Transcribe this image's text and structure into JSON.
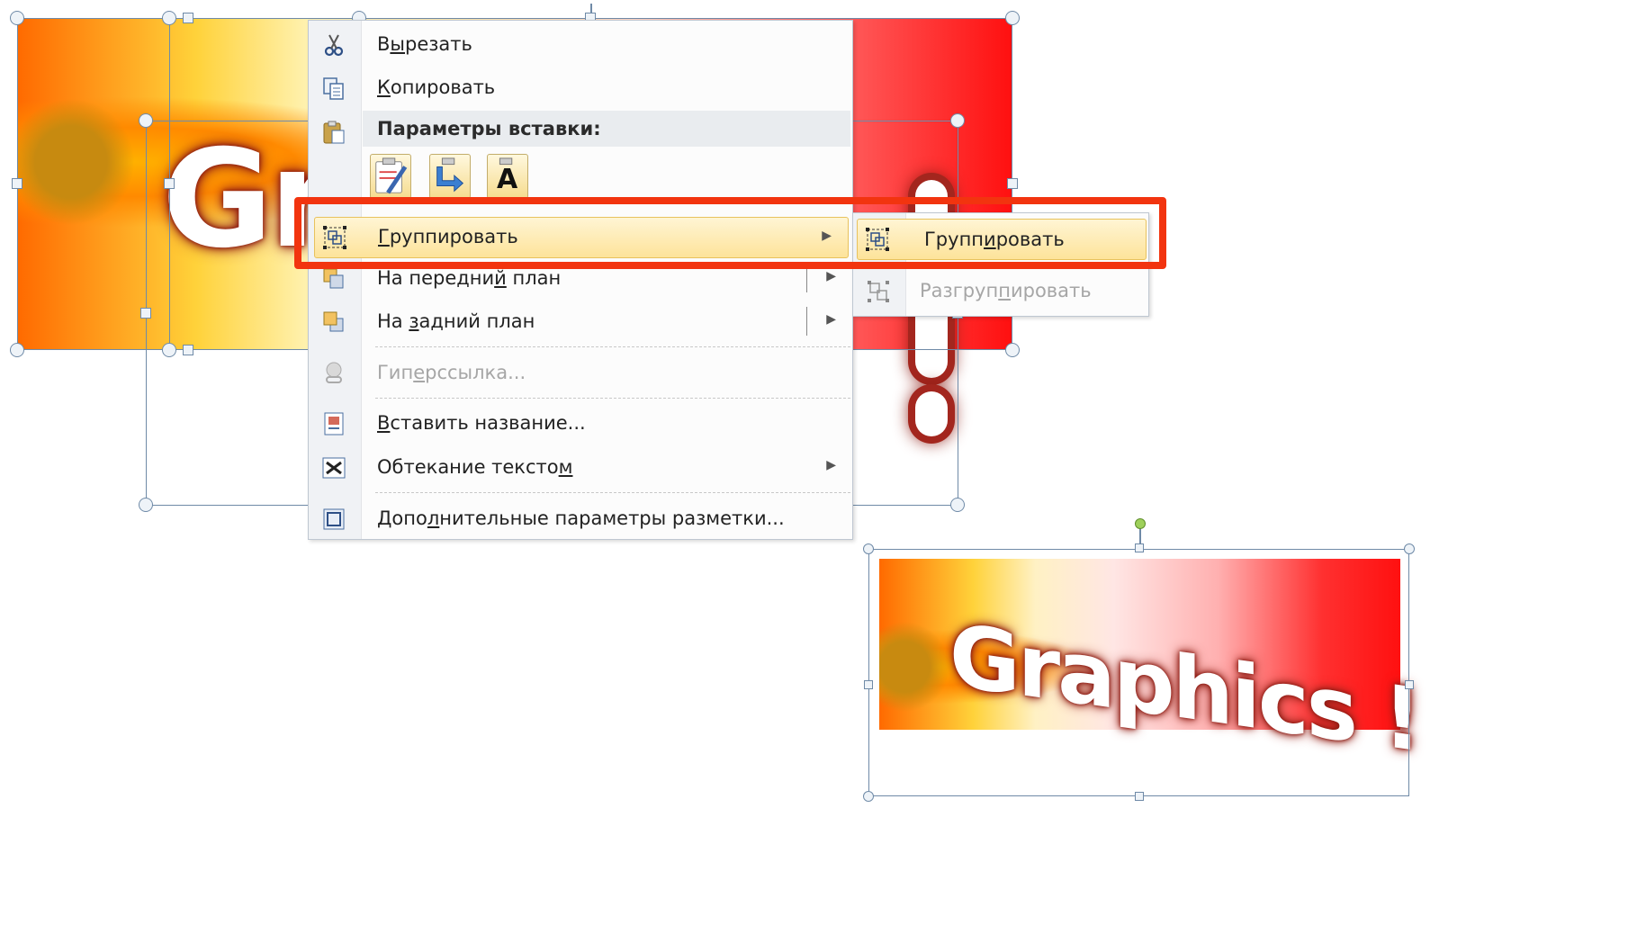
{
  "canvas_top": {
    "wordart_text": "Gr",
    "excl": "!"
  },
  "context_menu": {
    "items": [
      {
        "name": "cut",
        "pre": "В",
        "ul": "ы",
        "post": "резать",
        "icon": "scissors-icon"
      },
      {
        "name": "copy",
        "pre": "",
        "ul": "К",
        "post": "опировать",
        "icon": "copy-icon"
      }
    ],
    "paste_header": "Параметры вставки:",
    "paste_options": [
      {
        "name": "keep-source-formatting",
        "icon": "paste-brush-icon"
      },
      {
        "name": "use-destination",
        "icon": "paste-arrow-icon"
      },
      {
        "name": "keep-text-only",
        "icon": "paste-text-icon",
        "glyph": "A"
      }
    ],
    "group": {
      "pre": "",
      "ul": "Г",
      "post": "руппировать",
      "arrow": "▶"
    },
    "bring_front": {
      "pre": "На передни",
      "ul": "й",
      "post": " план",
      "arrow": "▶"
    },
    "send_back": {
      "pre": "На ",
      "ul": "з",
      "post": "адний план",
      "arrow": "▶"
    },
    "hyperlink": {
      "pre": "Гип",
      "ul": "е",
      "post": "рссылка..."
    },
    "insert_caption": {
      "pre": "",
      "ul": "В",
      "post": "ставить название..."
    },
    "text_wrap": {
      "pre": "Обтекание тексто",
      "ul": "м",
      "post": "",
      "arrow": "▶"
    },
    "more_layout": {
      "pre": "Допо",
      "ul": "л",
      "post": "нительные параметры разметки..."
    }
  },
  "submenu": {
    "group": {
      "pre": "Групп",
      "ul": "и",
      "post": "ровать"
    },
    "ungroup": {
      "pre": "Разгруп",
      "ul": "п",
      "post": "ировать"
    }
  },
  "canvas_bottom": {
    "wordart_text": "Graphics !"
  },
  "colors": {
    "highlight_frame": "#f2340f",
    "hot_item": "#fde39a",
    "selection": "#6f8aa7"
  }
}
